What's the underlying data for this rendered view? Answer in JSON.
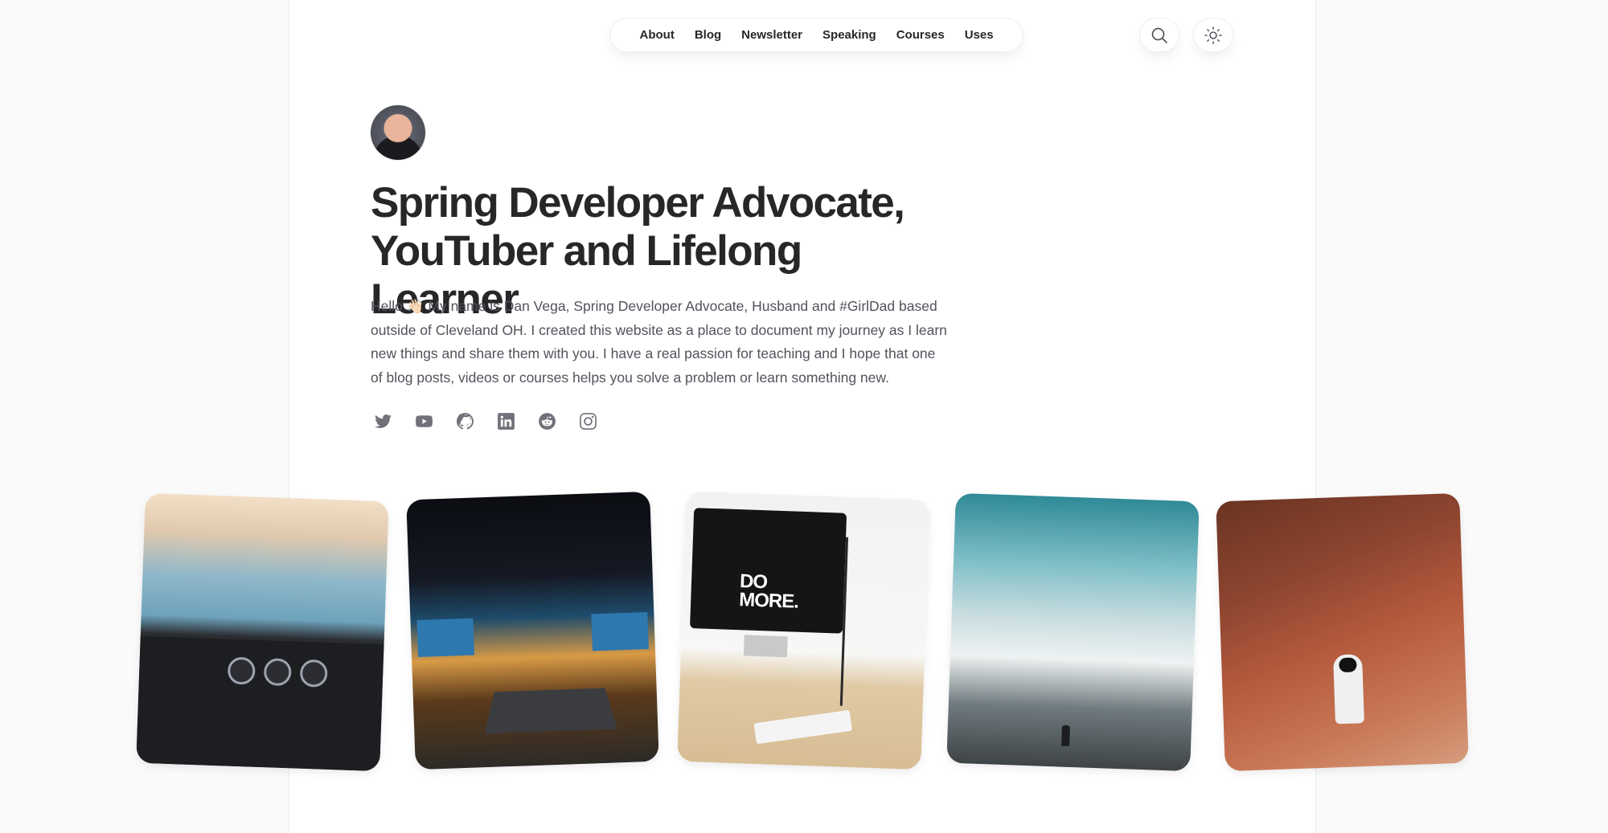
{
  "nav": {
    "items": [
      {
        "label": "About"
      },
      {
        "label": "Blog"
      },
      {
        "label": "Newsletter"
      },
      {
        "label": "Speaking"
      },
      {
        "label": "Courses"
      },
      {
        "label": "Uses"
      }
    ]
  },
  "actions": {
    "search_icon": "search-icon",
    "theme_icon": "sun-icon"
  },
  "hero": {
    "title_line1": "Spring Developer Advocate,",
    "title_line2": "YouTuber and Lifelong Learner",
    "intro": "Hello 👋🏻 My name is Dan Vega, Spring Developer Advocate, Husband and #GirlDad based outside of Cleveland OH. I created this website as a place to document my journey as I learn new things and share them with you. I have a real passion for teaching and I hope that one of blog posts, videos or courses helps you solve a problem or learn something new."
  },
  "socials": [
    {
      "icon": "twitter-icon"
    },
    {
      "icon": "youtube-icon"
    },
    {
      "icon": "github-icon"
    },
    {
      "icon": "linkedin-icon"
    },
    {
      "icon": "reddit-icon"
    },
    {
      "icon": "instagram-icon"
    }
  ],
  "photo_text": {
    "monitor_line1": "DO",
    "monitor_line2": "MORE."
  },
  "colors": {
    "text": "#27272a",
    "muted": "#52525b",
    "icon": "#71717a",
    "page_bg": "#fafafa",
    "card_bg": "#ffffff"
  }
}
